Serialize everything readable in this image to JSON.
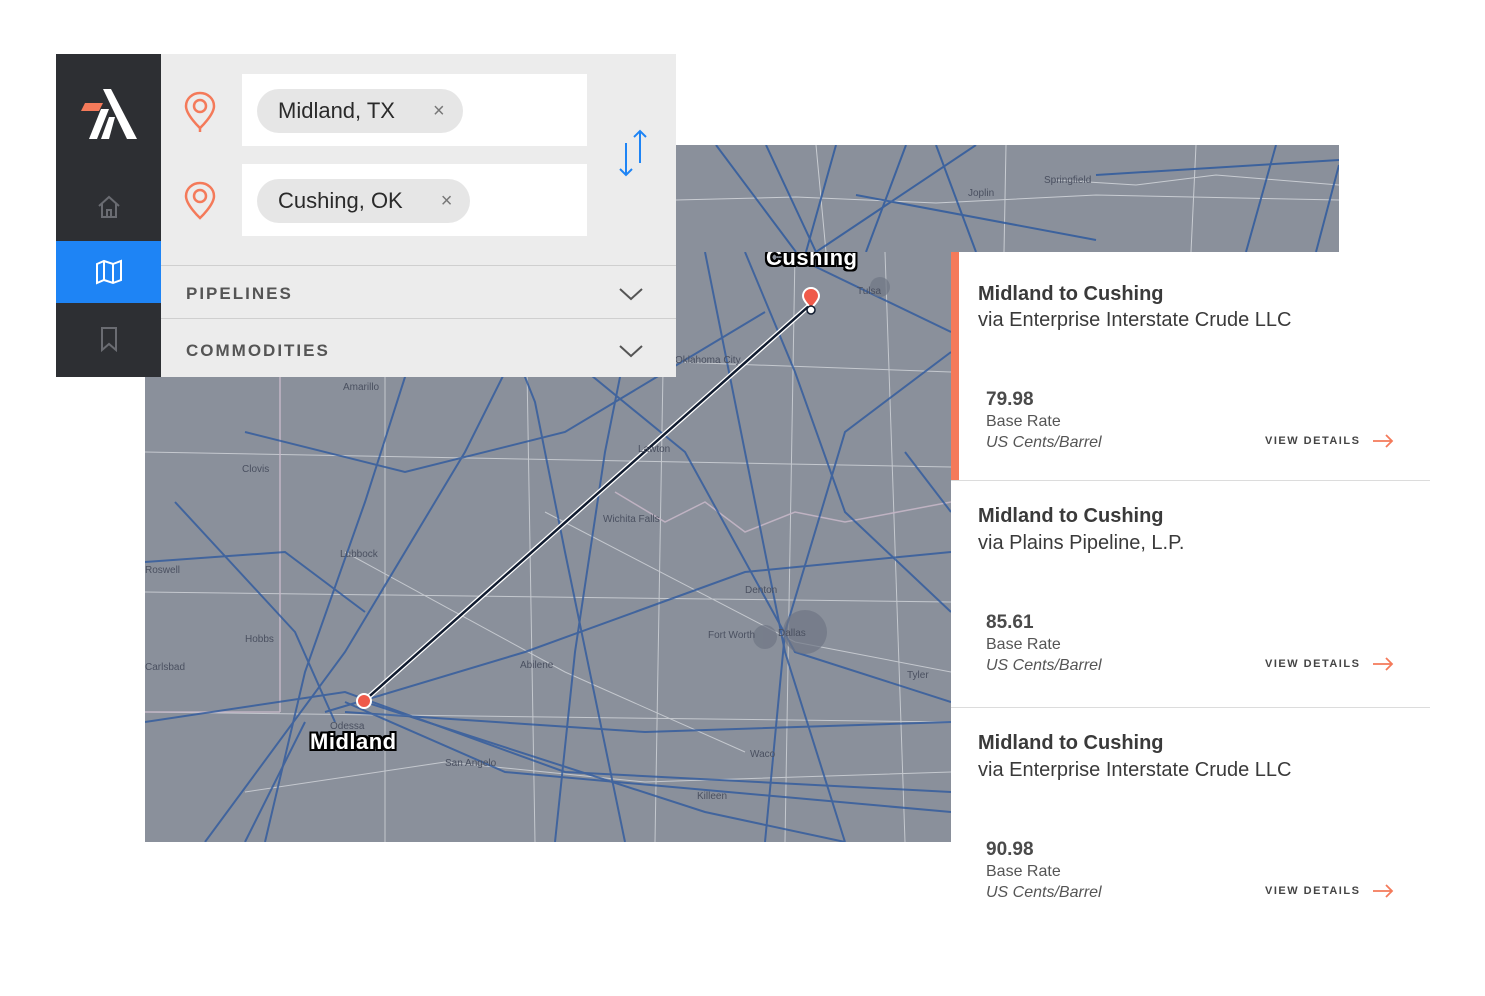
{
  "search": {
    "origin": "Midland, TX",
    "destination": "Cushing, OK",
    "clear_glyph": "×"
  },
  "nav": {
    "items": [
      {
        "name": "home",
        "icon": "home-icon",
        "active": false
      },
      {
        "name": "map",
        "icon": "map-icon",
        "active": true
      },
      {
        "name": "saved",
        "icon": "bookmark-icon",
        "active": false
      }
    ]
  },
  "filters": {
    "pipelines_label": "PIPELINES",
    "commodities_label": "COMMODITIES"
  },
  "map": {
    "origin_label": "Midland",
    "destination_label": "Cushing",
    "cities": [
      "Springfield",
      "Joplin",
      "Tulsa",
      "Oklahoma City",
      "Amarillo",
      "Clovis",
      "Lawton",
      "Wichita Falls",
      "Lubbock",
      "Hobbs",
      "Carlsbad",
      "Odessa",
      "Abilene",
      "San Angelo",
      "Denton",
      "Fort Worth",
      "Dallas",
      "Tyler",
      "Waco",
      "Killeen",
      "Roswell"
    ]
  },
  "results": [
    {
      "title": "Midland to Cushing",
      "via": "via Enterprise Interstate Crude LLC",
      "rate": "79.98",
      "rate_label": "Base Rate",
      "unit": "US Cents/Barrel",
      "link": "VIEW DETAILS",
      "selected": true
    },
    {
      "title": "Midland to Cushing",
      "via": "via Plains Pipeline, L.P.",
      "rate": "85.61",
      "rate_label": "Base Rate",
      "unit": "US Cents/Barrel",
      "link": "VIEW DETAILS",
      "selected": false
    },
    {
      "title": "Midland to Cushing",
      "via": "via Enterprise Interstate Crude LLC",
      "rate": "90.98",
      "rate_label": "Base Rate",
      "unit": "US Cents/Barrel",
      "link": "VIEW DETAILS",
      "selected": false
    }
  ],
  "colors": {
    "accent": "#f47a5a",
    "active_nav": "#1e84f5",
    "rail": "#2d2f33",
    "map_bg": "#8a909b",
    "pipeline": "#2f5a9e",
    "route": "#0f1a2e"
  }
}
